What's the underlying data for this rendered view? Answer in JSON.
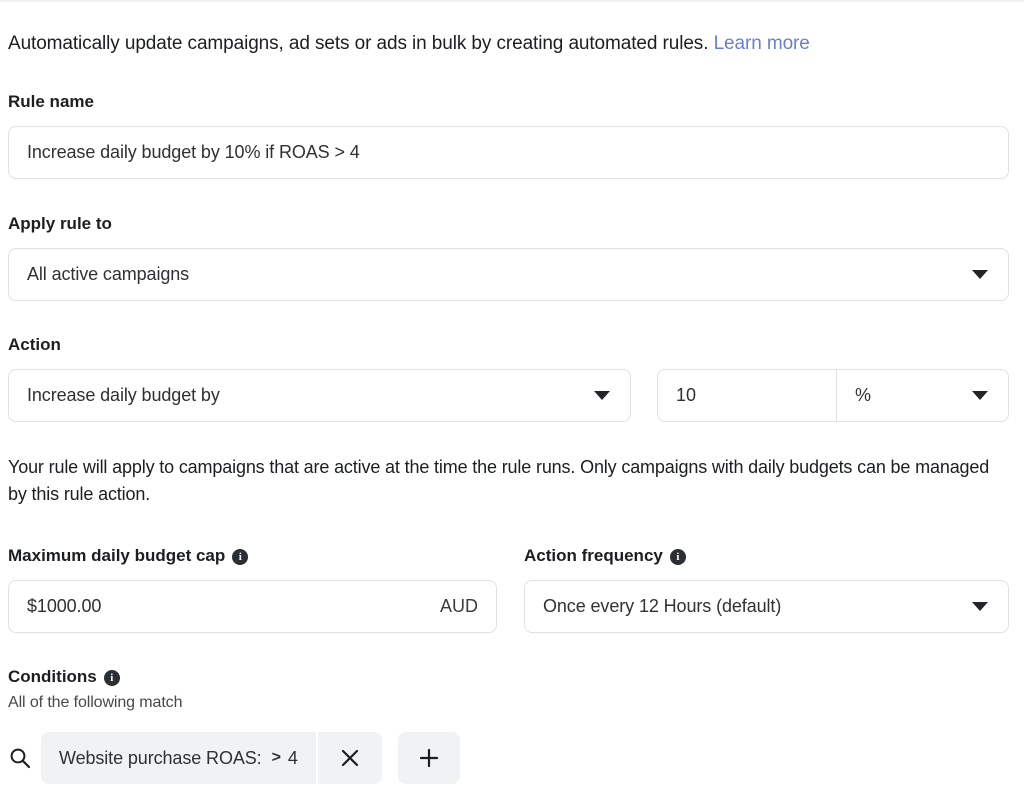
{
  "intro": {
    "text": "Automatically update campaigns, ad sets or ads in bulk by creating automated rules.",
    "link_label": "Learn more",
    "link_color": "#6b7fd0"
  },
  "rule_name": {
    "label": "Rule name",
    "value": "Increase daily budget by 10% if ROAS > 4",
    "placeholder": "Rule name"
  },
  "apply_rule_to": {
    "label": "Apply rule to",
    "value": "All active campaigns",
    "caret_icon": "chevron-down-icon"
  },
  "action": {
    "label": "Action",
    "type_value": "Increase daily budget by",
    "amount_value": "10",
    "unit_value": "%",
    "caret_icon": "chevron-down-icon",
    "note": "Your rule will apply to campaigns that are active at the time the rule runs. Only campaigns with daily budgets can be managed by this rule action."
  },
  "budget_cap": {
    "label": "Maximum daily budget cap",
    "info_icon": "info-icon",
    "value": "$1000.00",
    "currency_suffix": "AUD"
  },
  "action_frequency": {
    "label": "Action frequency",
    "info_icon": "info-icon",
    "value": "Once every 12 Hours (default)",
    "caret_icon": "chevron-down-icon"
  },
  "conditions": {
    "label": "Conditions",
    "info_icon": "info-icon",
    "subtitle": "All of the following match",
    "search_icon": "search-icon",
    "items": [
      {
        "metric": "Website purchase ROAS:",
        "operator": ">",
        "value": "4",
        "remove_icon": "close-icon"
      }
    ],
    "add_icon": "plus-icon"
  },
  "colors": {
    "border": "#dfe1e5",
    "chip_bg": "#f1f2f4",
    "text": "#1c1e21",
    "link": "#6b7fd0"
  }
}
